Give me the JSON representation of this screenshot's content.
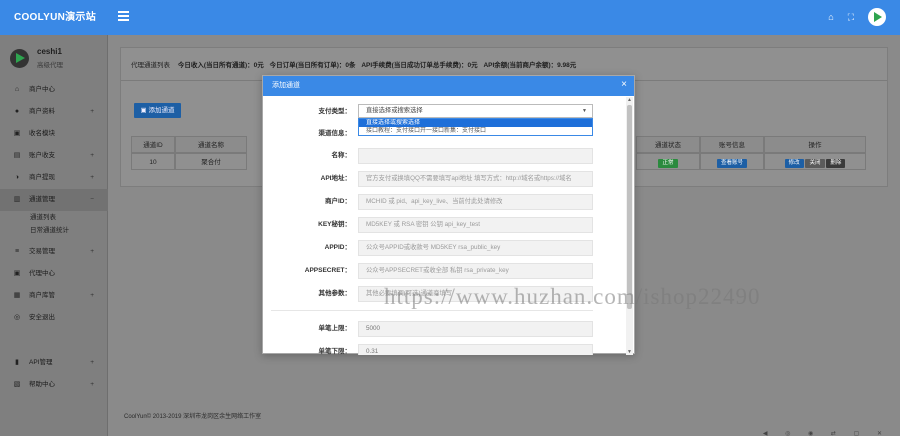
{
  "header": {
    "brand": "COOLYUN演示站"
  },
  "user": {
    "name": "ceshi1",
    "role": "高级代理"
  },
  "sidebar": {
    "items": [
      {
        "label": "商户中心",
        "icon": "home-icon",
        "glyph": "⌂",
        "plus": ""
      },
      {
        "label": "商户资料",
        "icon": "user-icon",
        "glyph": "●",
        "plus": "+"
      },
      {
        "label": "收名模块",
        "icon": "calendar-icon",
        "glyph": "▣",
        "plus": ""
      },
      {
        "label": "账户收支",
        "icon": "briefcase-icon",
        "glyph": "▤",
        "plus": "+"
      },
      {
        "label": "商户提现",
        "icon": "contrast-icon",
        "glyph": "◑",
        "plus": "+"
      },
      {
        "label": "通道管理",
        "icon": "bank-icon",
        "glyph": "▥",
        "plus": "−"
      },
      {
        "label": "交易管理",
        "icon": "list-icon",
        "glyph": "≡",
        "plus": "+"
      },
      {
        "label": "代理中心",
        "icon": "calendar-icon",
        "glyph": "▣",
        "plus": ""
      },
      {
        "label": "商户库管",
        "icon": "grid-icon",
        "glyph": "▦",
        "plus": "+"
      },
      {
        "label": "安全退出",
        "icon": "power-icon",
        "glyph": "◎",
        "plus": ""
      },
      {
        "label": "API管理",
        "icon": "mobile-icon",
        "glyph": "▮",
        "plus": "+"
      },
      {
        "label": "帮助中心",
        "icon": "book-icon",
        "glyph": "▧",
        "plus": "+"
      }
    ],
    "subs": [
      "通道列表",
      "日常通道统计"
    ]
  },
  "stats": {
    "prefix": "代理通道列表",
    "items": [
      "今日收入(当日所有通道)：0元",
      "今日订单(当日所有订单)：0条",
      "API手续费(当日成功订单总手续费)：0元",
      "API余额(当前商户余额)：9.98元"
    ]
  },
  "add_button": "添加通道",
  "table": {
    "headers": [
      "通道ID",
      "通道名称",
      "通道状态",
      "账号信息",
      "操作"
    ],
    "row": {
      "id": "10",
      "name": "聚合付",
      "status": "正常",
      "account": "查看账号",
      "actions": [
        "修改",
        "关闭",
        "删除"
      ]
    }
  },
  "modal": {
    "title": "添加通道",
    "fields": [
      {
        "label": "支付类型：",
        "value": "直接选择或搜索选择",
        "type": "select"
      },
      {
        "label": "渠道信息：",
        "value": "接口教程：支付接口开一接口新集：支付接口",
        "type": "text"
      },
      {
        "label": "名称：",
        "value": "",
        "type": "text"
      },
      {
        "label": "API地址：",
        "value": "官方支付或换填QQ不需要填写api地址 填写方式：http://域名或https://域名",
        "type": "text"
      },
      {
        "label": "商户ID：",
        "value": "MCHID 或 pid、api_key_live、当前付此处请修改",
        "type": "text"
      },
      {
        "label": "KEY秘钥：",
        "value": "MD5KEY 或 RSA 密钥 公钥 api_key_test",
        "type": "text"
      },
      {
        "label": "APPID：",
        "value": "公众号APPID或收款号 MD5KEY rsa_public_key",
        "type": "text"
      },
      {
        "label": "APPSECRET：",
        "value": "公众号APPSECRET或收全部 私钥 rsa_private_key",
        "type": "text"
      },
      {
        "label": "其他参数：",
        "value": "其他必要填调(可选)通道商填写",
        "type": "text"
      },
      {
        "label": "单笔上限：",
        "value": "5000",
        "type": "text"
      },
      {
        "label": "单笔下限：",
        "value": "0.31",
        "type": "text"
      }
    ],
    "dropdown": [
      "直接选择或搜索选择",
      "接口教程：支付接口开一接口新集：支付接口"
    ]
  },
  "footer": "CoolYun© 2013-2019 深圳市龙岗区余生网络工作室",
  "watermark": "https://www.huzhan.com/ishop22490"
}
